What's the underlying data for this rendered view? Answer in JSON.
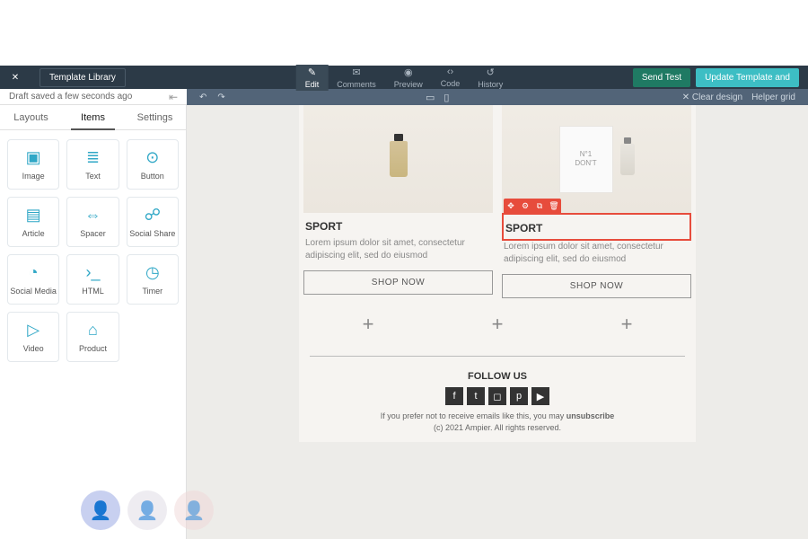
{
  "header": {
    "template_library": "Template Library",
    "center_tabs": [
      {
        "icon": "✎",
        "label": "Edit"
      },
      {
        "icon": "✉",
        "label": "Comments"
      },
      {
        "icon": "◉",
        "label": "Preview"
      },
      {
        "icon": "‹›",
        "label": "Code"
      },
      {
        "icon": "↺",
        "label": "History"
      }
    ],
    "send_test": "Send Test",
    "update": "Update Template and"
  },
  "secbar": {
    "draft_saved": "Draft saved a few seconds ago",
    "clear_design": "Clear design",
    "helper_grid": "Helper grid"
  },
  "sidebar": {
    "tabs": [
      "Layouts",
      "Items",
      "Settings"
    ],
    "items": [
      {
        "icon": "▣",
        "label": "Image"
      },
      {
        "icon": "≣",
        "label": "Text"
      },
      {
        "icon": "⊙",
        "label": "Button"
      },
      {
        "icon": "▤",
        "label": "Article"
      },
      {
        "icon": "⇔",
        "label": "Spacer"
      },
      {
        "icon": "☍",
        "label": "Social Share"
      },
      {
        "icon": "◔",
        "label": "Social Media"
      },
      {
        "icon": "›_",
        "label": "HTML"
      },
      {
        "icon": "◷",
        "label": "Timer"
      },
      {
        "icon": "▷",
        "label": "Video"
      },
      {
        "icon": "⌂",
        "label": "Product"
      }
    ]
  },
  "canvas": {
    "products": [
      {
        "title": "SPORT",
        "desc": "Lorem ipsum dolor sit amet, consectetur adipiscing elit, sed do eiusmod",
        "cta": "SHOP NOW",
        "boxtext": ""
      },
      {
        "title": "SPORT",
        "desc": "Lorem ipsum dolor sit amet, consectetur adipiscing elit, sed do eiusmod",
        "cta": "SHOP NOW",
        "boxtext": "N°1\nDON'T"
      }
    ],
    "footer": {
      "follow": "FOLLOW US",
      "prefer": "If you prefer not to receive emails like this, you may ",
      "unsubscribe": "unsubscribe",
      "copyright": "(c) 2021 Ampier. All rights reserved."
    }
  }
}
